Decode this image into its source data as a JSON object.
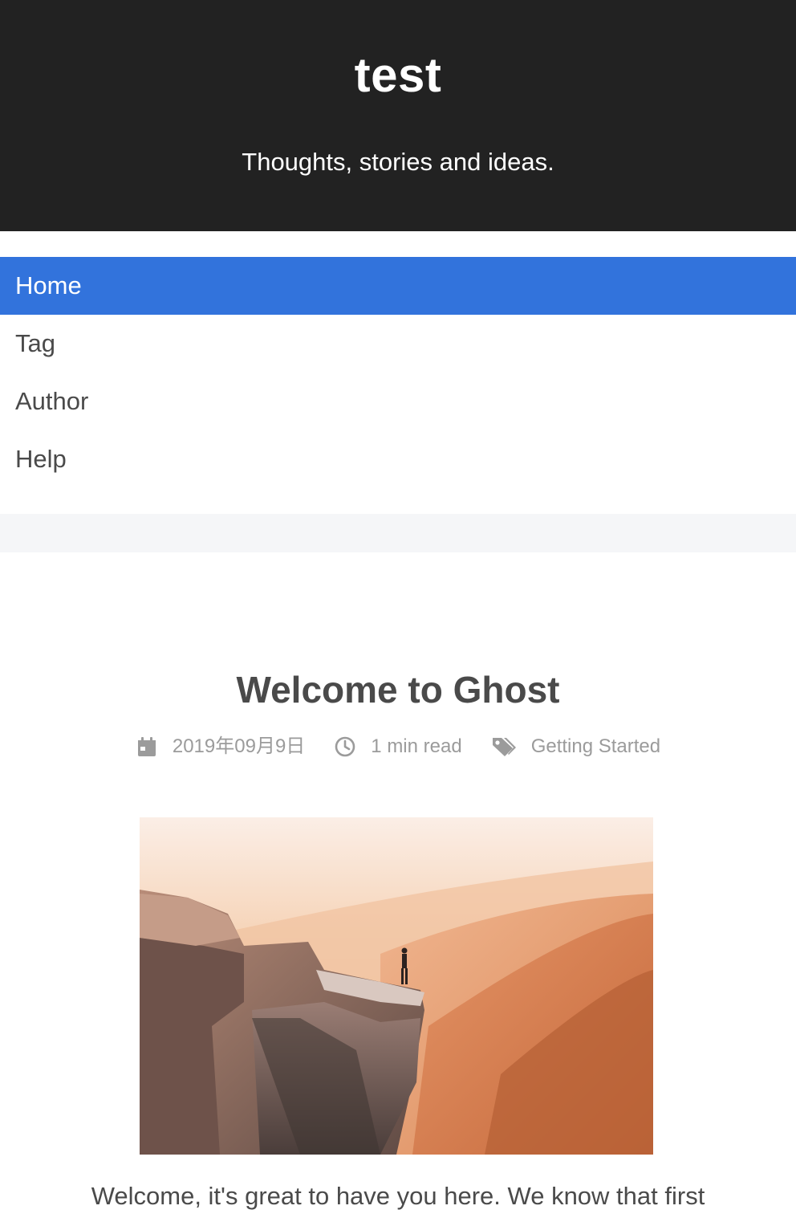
{
  "header": {
    "title": "test",
    "description": "Thoughts, stories and ideas."
  },
  "nav": {
    "items": [
      {
        "label": "Home",
        "active": true
      },
      {
        "label": "Tag",
        "active": false
      },
      {
        "label": "Author",
        "active": false
      },
      {
        "label": "Help",
        "active": false
      }
    ]
  },
  "post": {
    "title": "Welcome to Ghost",
    "date": "2019年09月9日",
    "read_time": "1 min read",
    "tag": "Getting Started",
    "excerpt": "Welcome, it's great to have you here. We know that first"
  },
  "colors": {
    "header_bg": "#222222",
    "accent": "#3273dc",
    "band": "#f5f6f8",
    "text": "#4a4a4a",
    "meta": "#9b9b9b"
  },
  "icons": {
    "date": "calendar-icon",
    "read_time": "clock-icon",
    "tag": "tags-icon"
  }
}
